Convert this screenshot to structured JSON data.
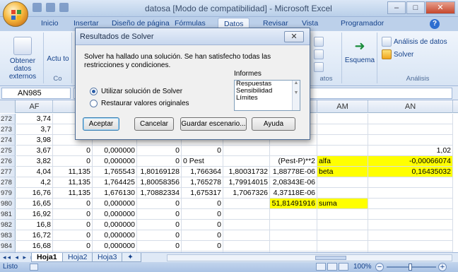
{
  "window": {
    "title": "datosa  [Modo de compatibilidad] - Microsoft Excel",
    "minimize": "‒",
    "maximize": "□",
    "close": "✕"
  },
  "ribbon_tabs": [
    "Inicio",
    "Insertar",
    "Diseño de página",
    "Fórmulas",
    "Datos",
    "Revisar",
    "Vista",
    "Programador"
  ],
  "ribbon": {
    "obtener_datos": "Obtener datos externos",
    "actualizar_partial": "Actu to",
    "conexiones_partial": "Co",
    "herramientas_partial": "atos",
    "esquema": "Esquema",
    "analisis_datos": "Análisis de datos",
    "solver": "Solver",
    "analisis_group": "Análisis"
  },
  "formula_bar": {
    "name_box": "AN985",
    "formula": ""
  },
  "columns": [
    "AF",
    "AL",
    "AM",
    "AN"
  ],
  "rows": [
    {
      "n": "272",
      "af": "3,74",
      "ag": "",
      "ah": "",
      "ai": "",
      "aj": "",
      "ak": "",
      "al": "",
      "am": "",
      "an": ""
    },
    {
      "n": "273",
      "af": "3,7",
      "ag": "",
      "ah": "",
      "ai": "",
      "aj": "",
      "ak": "",
      "al": "",
      "am": "",
      "an": ""
    },
    {
      "n": "274",
      "af": "3,98",
      "ag": "",
      "ah": "",
      "ai": "",
      "aj": "",
      "ak": "",
      "al": "",
      "am": "",
      "an": ""
    },
    {
      "n": "275",
      "af": "3,67",
      "ag": "0",
      "ah": "0,000000",
      "ai": "0",
      "aj": "0",
      "ak": "",
      "al": "",
      "am": "",
      "an": "1,02"
    },
    {
      "n": "276",
      "af": "3,82",
      "ag": "0",
      "ah": "0,000000",
      "ai": "0",
      "aj": "0 Pest",
      "ak": "",
      "al": "(Pest-P)**2",
      "am": "alfa",
      "an": "-0,00066074"
    },
    {
      "n": "277",
      "af": "4,04",
      "ag": "11,135",
      "ah": "1,765543",
      "ai": "1,80169128",
      "aj": "1,766364",
      "ak": "1,80031732",
      "al": "1,88778E-06",
      "am": "beta",
      "an": "0,16435032"
    },
    {
      "n": "278",
      "af": "4,2",
      "ag": "11,135",
      "ah": "1,764425",
      "ai": "1,80058356",
      "aj": "1,765278",
      "ak": "1,79914015",
      "al": "2,08343E-06",
      "am": "",
      "an": ""
    },
    {
      "n": "979",
      "af": "16,76",
      "ag": "11,135",
      "ah": "1,676130",
      "ai": "1,70882334",
      "aj": "1,675317",
      "ak": "1,7067326",
      "al": "4,37118E-06",
      "am": "",
      "an": ""
    },
    {
      "n": "980",
      "af": "16,65",
      "ag": "0",
      "ah": "0,000000",
      "ai": "0",
      "aj": "0",
      "ak": "",
      "al": "51,81491916",
      "am": "suma",
      "an": ""
    },
    {
      "n": "981",
      "af": "16,92",
      "ag": "0",
      "ah": "0,000000",
      "ai": "0",
      "aj": "0",
      "ak": "",
      "al": "",
      "am": "",
      "an": ""
    },
    {
      "n": "982",
      "af": "16,8",
      "ag": "0",
      "ah": "0,000000",
      "ai": "0",
      "aj": "0",
      "ak": "",
      "al": "",
      "am": "",
      "an": ""
    },
    {
      "n": "983",
      "af": "16,72",
      "ag": "0",
      "ah": "0,000000",
      "ai": "0",
      "aj": "0",
      "ak": "",
      "al": "",
      "am": "",
      "an": ""
    },
    {
      "n": "984",
      "af": "16,68",
      "ag": "0",
      "ah": "0,000000",
      "ai": "0",
      "aj": "0",
      "ak": "",
      "al": "",
      "am": "",
      "an": ""
    },
    {
      "n": "985",
      "af": "16,22",
      "ag": "0",
      "ah": "0,000000",
      "ai": "0",
      "aj": "0",
      "ak": "",
      "al": "",
      "am": "",
      "an": ""
    }
  ],
  "sheet_tabs": [
    "Hoja1",
    "Hoja2",
    "Hoja3"
  ],
  "status": {
    "mode": "Listo",
    "zoom": "100%"
  },
  "dialog": {
    "title": "Resultados de Solver",
    "close": "✕",
    "message": "Solver ha hallado una solución. Se han satisfecho todas las restricciones y condiciones.",
    "informes_label": "Informes",
    "informes": [
      "Respuestas",
      "Sensibilidad",
      "Límites"
    ],
    "radio_keep": "Utilizar solución de Solver",
    "radio_restore": "Restaurar valores originales",
    "btn_ok": "Aceptar",
    "btn_cancel": "Cancelar",
    "btn_save": "Guardar escenario...",
    "btn_help": "Ayuda"
  },
  "colors": {
    "highlight": "#ffff00",
    "ribbon_text": "#15428b"
  }
}
